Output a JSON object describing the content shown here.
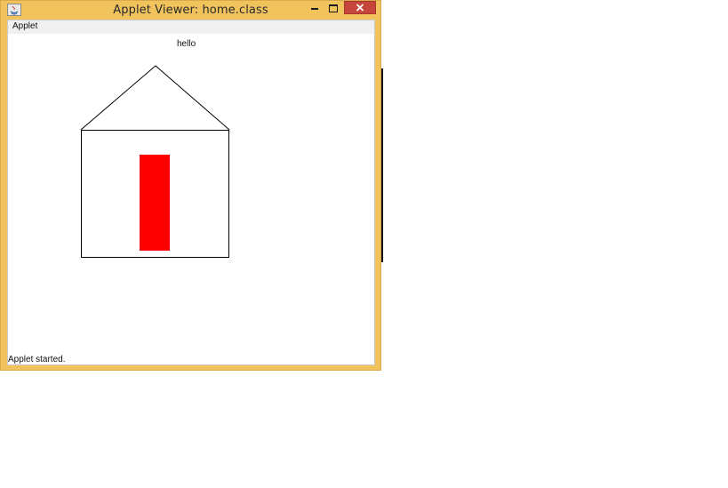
{
  "window": {
    "title": "Applet Viewer: home.class"
  },
  "menubar": {
    "items": [
      "Applet"
    ]
  },
  "canvas": {
    "text": "hello",
    "door_color": "#ff0000"
  },
  "status": {
    "text": "Applet started."
  },
  "colors": {
    "frame": "#f0c35d",
    "close_button": "#c7463b"
  }
}
